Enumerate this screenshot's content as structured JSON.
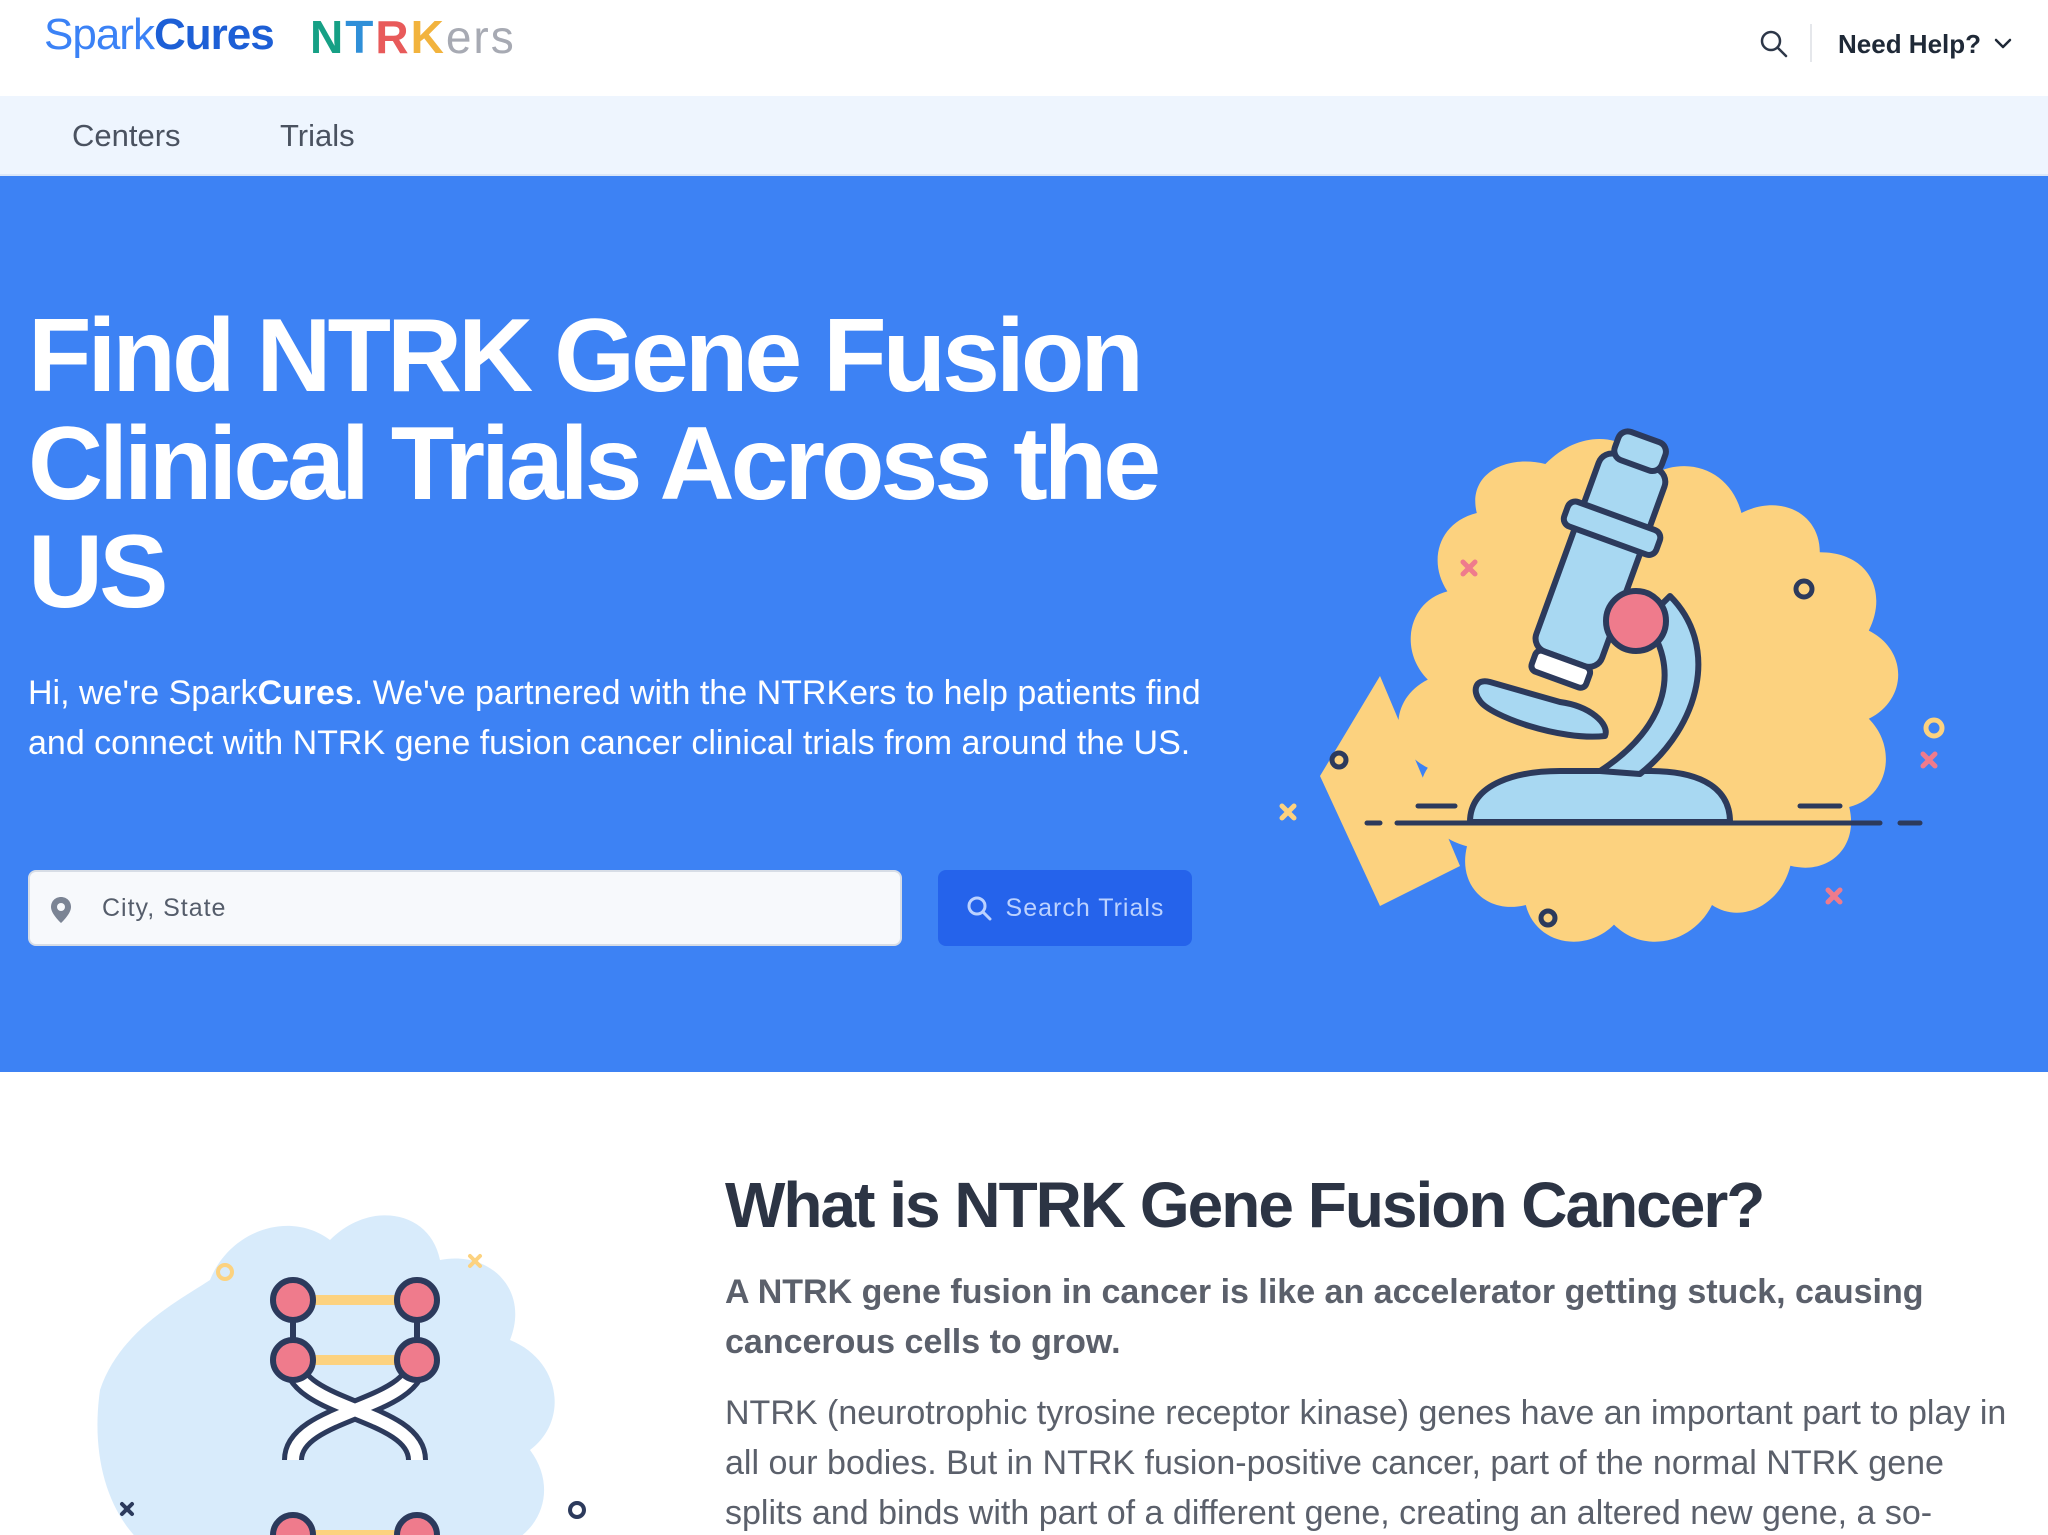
{
  "header": {
    "logo_spark": "Spark",
    "logo_cures": "Cures",
    "partner_logo": {
      "letters": [
        {
          "char": "N",
          "color": "#16a085"
        },
        {
          "char": "T",
          "color": "#2f8fd8"
        },
        {
          "char": "R",
          "color": "#e85a5a"
        },
        {
          "char": "K",
          "color": "#f2b33d"
        }
      ],
      "suffix": "ers"
    },
    "search_icon": "search-icon",
    "help_label": "Need Help?"
  },
  "nav": {
    "items": [
      "Centers",
      "Trials"
    ]
  },
  "hero": {
    "title": "Find NTRK Gene Fusion Clinical Trials Across the US",
    "intro_prefix": "Hi, we're Spark",
    "intro_brand": "Cures",
    "intro_rest": ". We've partnered with the NTRKers to help patients find and connect with NTRK gene fusion cancer clinical trials from around the US.",
    "location_placeholder": "City, State",
    "search_button": "Search Trials",
    "illustration": "microscope-illustration"
  },
  "info": {
    "title": "What is NTRK Gene Fusion Cancer?",
    "lead": "A NTRK gene fusion in cancer is like an accelerator getting stuck, causing cancerous cells to grow.",
    "body": "NTRK (neurotrophic tyrosine receptor kinase) genes have an important part to play in all our bodies. But in NTRK fusion-positive cancer, part of the normal NTRK gene splits and binds with part of a different gene, creating an altered new gene, a so-",
    "illustration": "dna-illustration"
  },
  "colors": {
    "hero_bg": "#3d82f4",
    "button_bg": "#2563eb",
    "nav_bg": "#eef5fe",
    "brand_blue": "#3b82f6"
  }
}
